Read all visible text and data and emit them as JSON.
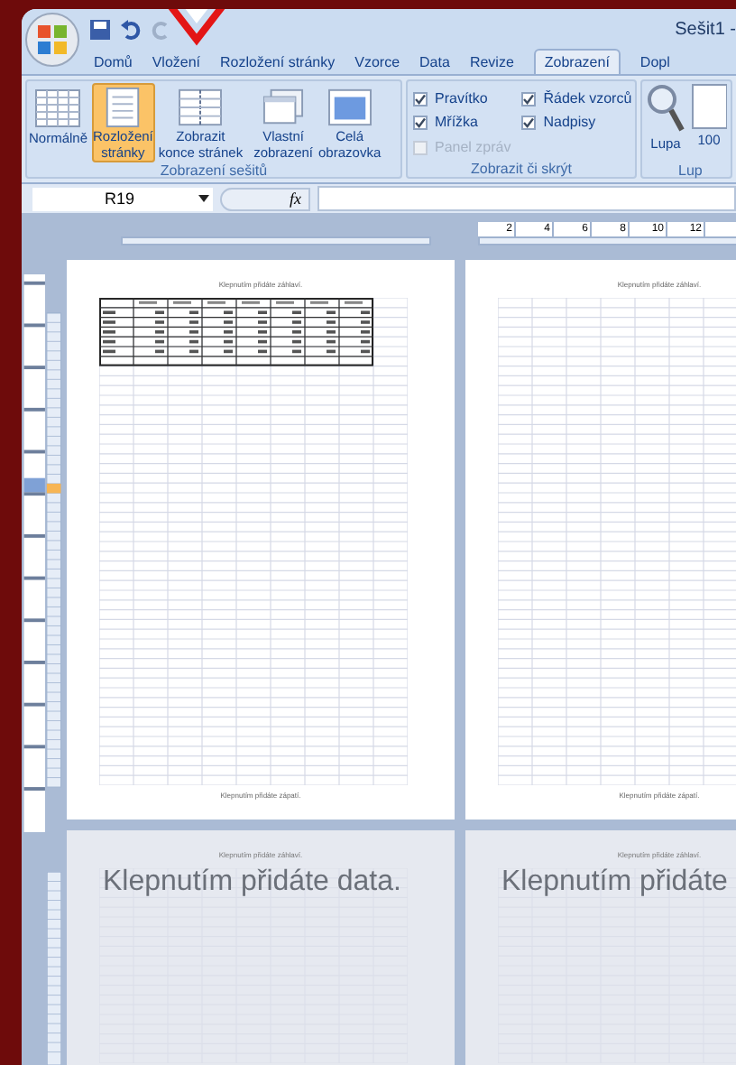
{
  "window": {
    "title": "Sešit1 -"
  },
  "tabs": [
    {
      "label": "Domů",
      "selected": false
    },
    {
      "label": "Vložení",
      "selected": false
    },
    {
      "label": "Rozložení stránky",
      "selected": false
    },
    {
      "label": "Vzorce",
      "selected": false
    },
    {
      "label": "Data",
      "selected": false
    },
    {
      "label": "Revize",
      "selected": false
    },
    {
      "label": "Zobrazení",
      "selected": true
    },
    {
      "label": "Dopl",
      "selected": false
    }
  ],
  "ribbon": {
    "view_group": {
      "label": "Zobrazení sešitů",
      "buttons": [
        {
          "kind": "normal",
          "label": "Normálně",
          "selected": false
        },
        {
          "kind": "layout",
          "label": "Rozložení\nstránky",
          "selected": true
        },
        {
          "kind": "breaks",
          "label": "Zobrazit\nkonce stránek",
          "selected": false
        },
        {
          "kind": "custom",
          "label": "Vlastní\nzobrazení",
          "selected": false
        },
        {
          "kind": "full",
          "label": "Celá\nobrazovka",
          "selected": false
        }
      ]
    },
    "show_group": {
      "label": "Zobrazit či skrýt",
      "checkboxes": [
        {
          "label": "Pravítko",
          "checked": true,
          "disabled": false
        },
        {
          "label": "Mřížka",
          "checked": true,
          "disabled": false
        },
        {
          "label": "Panel zpráv",
          "checked": false,
          "disabled": true
        },
        {
          "label": "Řádek vzorců",
          "checked": true,
          "disabled": false
        },
        {
          "label": "Nadpisy",
          "checked": true,
          "disabled": false
        }
      ]
    },
    "zoom_group": {
      "label": "Lup",
      "buttons": [
        {
          "kind": "zoom",
          "label": "Lupa"
        },
        {
          "kind": "percent",
          "label": "100"
        }
      ]
    }
  },
  "formula_bar": {
    "name_box": "R19",
    "function_label": "fx"
  },
  "ruler": [
    "2",
    "4",
    "6",
    "8",
    "10",
    "12"
  ],
  "pages": [
    {
      "header": "Klepnutím přidáte záhlaví.",
      "footer": "Klepnutím přidáte zápatí.",
      "has_data": true
    },
    {
      "header": "Klepnutím přidáte záhlaví.",
      "footer": "Klepnutím přidáte zápatí.",
      "has_data": false
    }
  ],
  "empty_pages": [
    {
      "header": "Klepnutím přidáte záhlaví.",
      "prompt": "Klepnutím přidáte data."
    },
    {
      "header": "Klepnutím přidáte záhlaví.",
      "prompt": "Klepnutím přidáte"
    }
  ]
}
